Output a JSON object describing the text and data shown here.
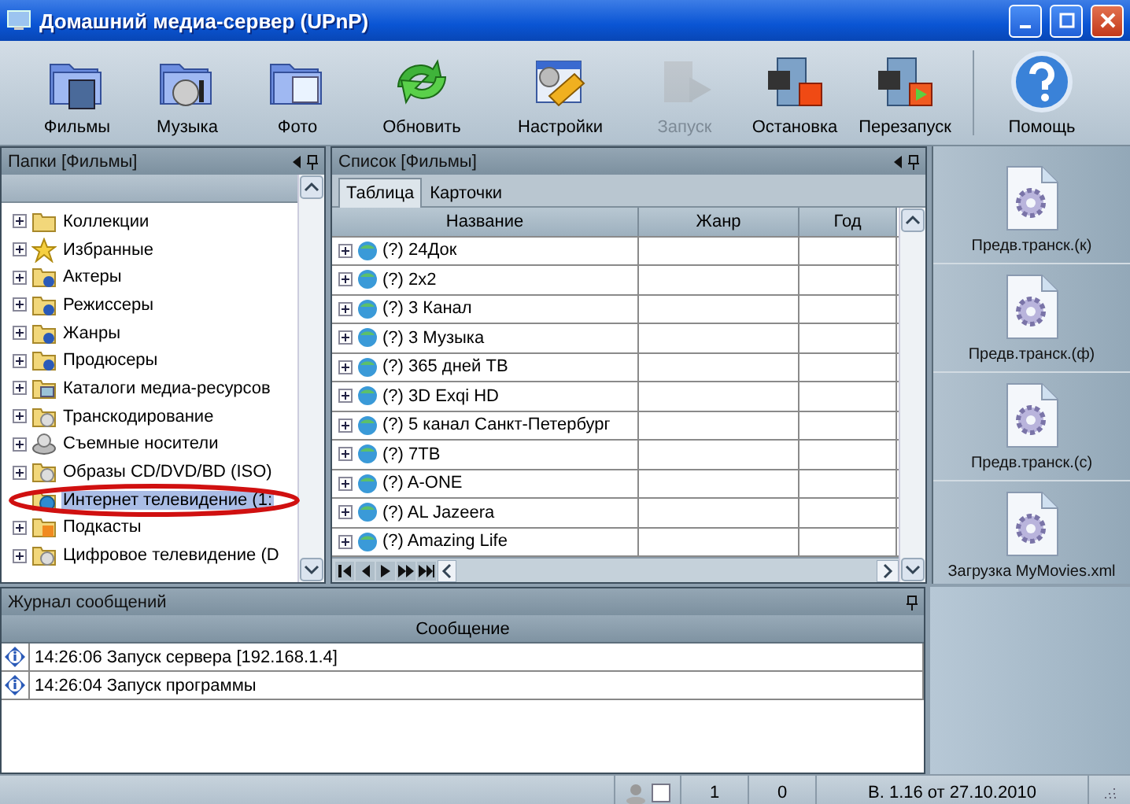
{
  "window": {
    "title": "Домашний медиа-сервер (UPnP)"
  },
  "toolbar": [
    {
      "label": "Фильмы",
      "kind": "film",
      "disabled": false
    },
    {
      "label": "Музыка",
      "kind": "music",
      "disabled": false
    },
    {
      "label": "Фото",
      "kind": "photo",
      "disabled": false
    },
    {
      "label": "Обновить",
      "kind": "refresh",
      "disabled": false
    },
    {
      "label": "Настройки",
      "kind": "settings",
      "disabled": false
    },
    {
      "label": "Запуск",
      "kind": "start",
      "disabled": true
    },
    {
      "label": "Остановка",
      "kind": "stop",
      "disabled": false
    },
    {
      "label": "Перезапуск",
      "kind": "restart",
      "disabled": false
    },
    {
      "label": "Помощь",
      "kind": "help",
      "disabled": false
    }
  ],
  "folders": {
    "title": "Папки [Фильмы]",
    "items": [
      {
        "label": "Коллекции",
        "kind": "folder",
        "expandable": true,
        "selected": false
      },
      {
        "label": "Избранные",
        "kind": "star",
        "expandable": true,
        "selected": false
      },
      {
        "label": "Актеры",
        "kind": "people",
        "expandable": true,
        "selected": false
      },
      {
        "label": "Режиссеры",
        "kind": "people",
        "expandable": true,
        "selected": false
      },
      {
        "label": "Жанры",
        "kind": "people",
        "expandable": true,
        "selected": false
      },
      {
        "label": "Продюсеры",
        "kind": "people",
        "expandable": true,
        "selected": false
      },
      {
        "label": "Каталоги медиа-ресурсов",
        "kind": "catalog",
        "expandable": true,
        "selected": false
      },
      {
        "label": "Транскодирование",
        "kind": "disc",
        "expandable": true,
        "selected": false
      },
      {
        "label": "Съемные носители",
        "kind": "drive",
        "expandable": true,
        "selected": false
      },
      {
        "label": "Образы CD/DVD/BD (ISO)",
        "kind": "disc",
        "expandable": true,
        "selected": false
      },
      {
        "label": "Интернет телевидение (1:",
        "kind": "globe",
        "expandable": false,
        "selected": true
      },
      {
        "label": "Подкасты",
        "kind": "rss",
        "expandable": true,
        "selected": false
      },
      {
        "label": "Цифровое телевидение (D",
        "kind": "disc",
        "expandable": true,
        "selected": false
      }
    ]
  },
  "list": {
    "title": "Список [Фильмы]",
    "tabs": [
      {
        "label": "Таблица",
        "selected": true
      },
      {
        "label": "Карточки",
        "selected": false
      }
    ],
    "columns": [
      "Название",
      "Жанр",
      "Год"
    ],
    "rows": [
      {
        "name": "(?) 24Док"
      },
      {
        "name": "(?) 2x2"
      },
      {
        "name": "(?) 3 Канал"
      },
      {
        "name": "(?) 3 Музыка"
      },
      {
        "name": "(?) 365 дней ТВ"
      },
      {
        "name": "(?) 3D Exqi HD"
      },
      {
        "name": "(?) 5 канал Санкт-Петербург"
      },
      {
        "name": "(?) 7ТВ"
      },
      {
        "name": "(?) A-ONE"
      },
      {
        "name": "(?) AL Jazeera"
      },
      {
        "name": "(?) Amazing Life"
      }
    ]
  },
  "actions": [
    {
      "label": "Предв.транск.(к)"
    },
    {
      "label": "Предв.транск.(ф)"
    },
    {
      "label": "Предв.транск.(c)"
    },
    {
      "label": "Загрузка MyMovies.xml"
    }
  ],
  "log": {
    "title": "Журнал сообщений",
    "column": "Сообщение",
    "messages": [
      "14:26:06 Запуск сервера [192.168.1.4]",
      "14:26:04 Запуск программы"
    ]
  },
  "status_bar": {
    "checked": false,
    "count_1": "1",
    "count_2": "0",
    "version": "В. 1.16 от 27.10.2010"
  }
}
